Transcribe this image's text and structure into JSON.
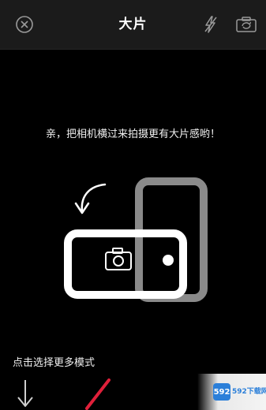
{
  "header": {
    "title": "大片"
  },
  "icons": {
    "close": "close-circle-icon",
    "flash": "flash-off-icon",
    "switch_camera": "switch-camera-icon",
    "rotate": "rotate-arrow-icon",
    "camera": "camera-icon",
    "down_arrow": "down-arrow-icon"
  },
  "main": {
    "hint": "亲，把相机横过来拍摄更有大片感哟！"
  },
  "bottom": {
    "mode_hint": "点击选择更多模式"
  },
  "watermark": {
    "logo": "592",
    "text": "592下载网"
  },
  "colors": {
    "background": "#000000",
    "topbar": "#1b1b1b",
    "phone_gray": "#8a8a8a",
    "phone_white": "#ffffff",
    "accent_red": "#e0203a"
  }
}
